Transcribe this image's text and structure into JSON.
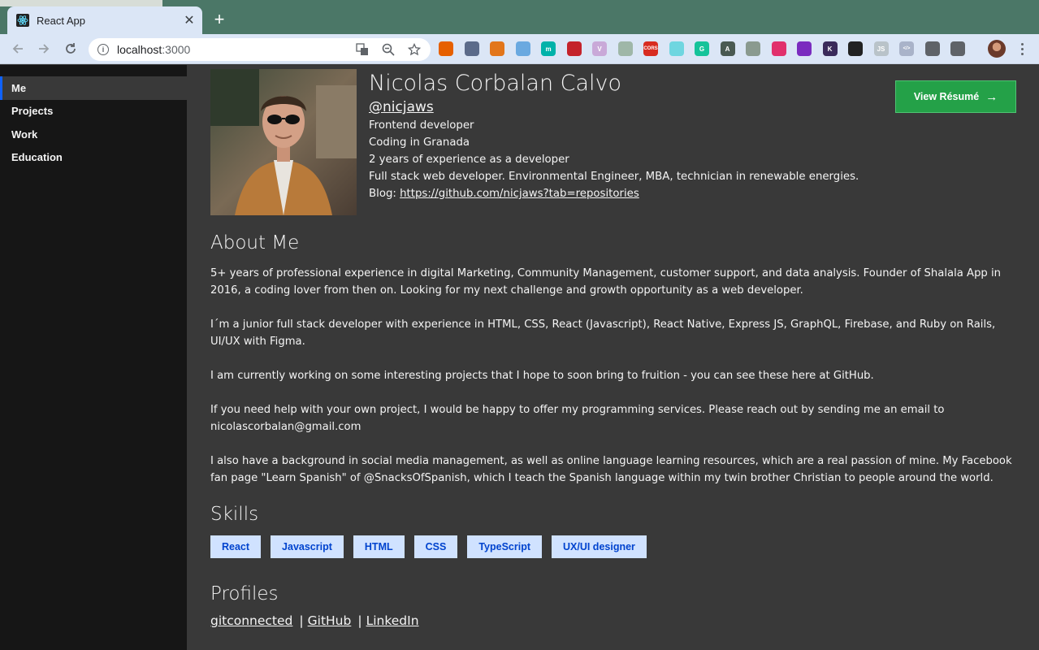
{
  "browser": {
    "tab_title": "React App",
    "new_tab_label": "+",
    "url_host": "localhost",
    "url_port": ":3000",
    "extensions": [
      {
        "name": "fox-ext-icon",
        "color": "#e66000",
        "glyph": ""
      },
      {
        "name": "tool-ext-icon",
        "color": "#5b6b8a",
        "glyph": ""
      },
      {
        "name": "metamask-icon",
        "color": "#e2761b",
        "glyph": ""
      },
      {
        "name": "sync-ext-icon",
        "color": "#6aa9e0",
        "glyph": ""
      },
      {
        "name": "m-ext-icon",
        "color": "#00b2a9",
        "glyph": "m"
      },
      {
        "name": "red-ext-icon",
        "color": "#c4232b",
        "glyph": ""
      },
      {
        "name": "vue-devtools-icon",
        "color": "#c9a9d8",
        "glyph": "V"
      },
      {
        "name": "timer-ext-icon",
        "color": "#9fb7a8",
        "glyph": ""
      },
      {
        "name": "cors-ext-icon",
        "color": "#d82c20",
        "glyph": "CORS"
      },
      {
        "name": "cyan-ext-icon",
        "color": "#6fd6e0",
        "glyph": ""
      },
      {
        "name": "grammarly-icon",
        "color": "#15c39a",
        "glyph": "G"
      },
      {
        "name": "a-ext-icon",
        "color": "#4a5a52",
        "glyph": "A"
      },
      {
        "name": "stats-ext-icon",
        "color": "#8a9a8f",
        "glyph": ""
      },
      {
        "name": "instagram-ext-icon",
        "color": "#e1306c",
        "glyph": ""
      },
      {
        "name": "chart-ext-icon",
        "color": "#7b2cbf",
        "glyph": ""
      },
      {
        "name": "k-ext-icon",
        "color": "#3a2a5a",
        "glyph": "K"
      },
      {
        "name": "frame-ext-icon",
        "color": "#222222",
        "glyph": ""
      },
      {
        "name": "js-ext-icon",
        "color": "#b9c3c9",
        "glyph": "JS"
      },
      {
        "name": "code-ext-icon",
        "color": "#a9b3c9",
        "glyph": "</>"
      },
      {
        "name": "puzzle-extensions-icon",
        "color": "#5f6368",
        "glyph": ""
      },
      {
        "name": "reading-list-icon",
        "color": "#5f6368",
        "glyph": ""
      }
    ]
  },
  "sidebar": {
    "items": [
      {
        "label": "Me",
        "active": true
      },
      {
        "label": "Projects",
        "active": false
      },
      {
        "label": "Work",
        "active": false
      },
      {
        "label": "Education",
        "active": false
      }
    ]
  },
  "profile": {
    "name": "Nicolas Corbalan Calvo",
    "handle": "@nicjaws",
    "role": "Frontend developer",
    "location": "Coding in Granada",
    "experience": "2 years of experience as a developer",
    "summary": "Full stack web developer. Environmental Engineer, MBA, technician in renewable energies.",
    "blog_label": "Blog: ",
    "blog_url": "https://github.com/nicjaws?tab=repositories",
    "resume_button": "View Résumé",
    "resume_arrow": "→"
  },
  "about": {
    "title": "About Me",
    "paragraphs": [
      "5+ years of professional experience in digital Marketing, Community Management, customer support, and data analysis. Founder of Shalala App in 2016, a coding lover from then on. Looking for my next challenge and growth opportunity as a web developer.",
      "I´m a junior full stack developer with experience in HTML, CSS, React (Javascript), React Native, Express JS, GraphQL, Firebase, and Ruby on Rails, UI/UX with Figma.",
      "I am currently working on some interesting projects that I hope to soon bring to fruition - you can see these here at GitHub.",
      "If you need help with your own project, I would be happy to offer my programming services. Please reach out by sending me an email to nicolascorbalan@gmail.com",
      "I also have a background in social media management, as well as online language learning resources, which are a real passion of mine. My Facebook fan page \"Learn Spanish\" of @SnacksOfSpanish, which I teach the Spanish language within my twin brother Christian to people around the world."
    ]
  },
  "skills": {
    "title": "Skills",
    "items": [
      "React",
      "Javascript",
      "HTML",
      "CSS",
      "TypeScript",
      "UX/UI designer"
    ]
  },
  "profiles": {
    "title": "Profiles",
    "links": [
      "gitconnected",
      "GitHub",
      "LinkedIn"
    ],
    "separator": "|"
  },
  "colors": {
    "accent": "#0f62fe",
    "resume_button": "#24a148",
    "skill_tag_bg": "#d0e2ff",
    "skill_tag_text": "#0043ce",
    "page_bg": "#393939",
    "sidebar_bg": "#161616"
  }
}
